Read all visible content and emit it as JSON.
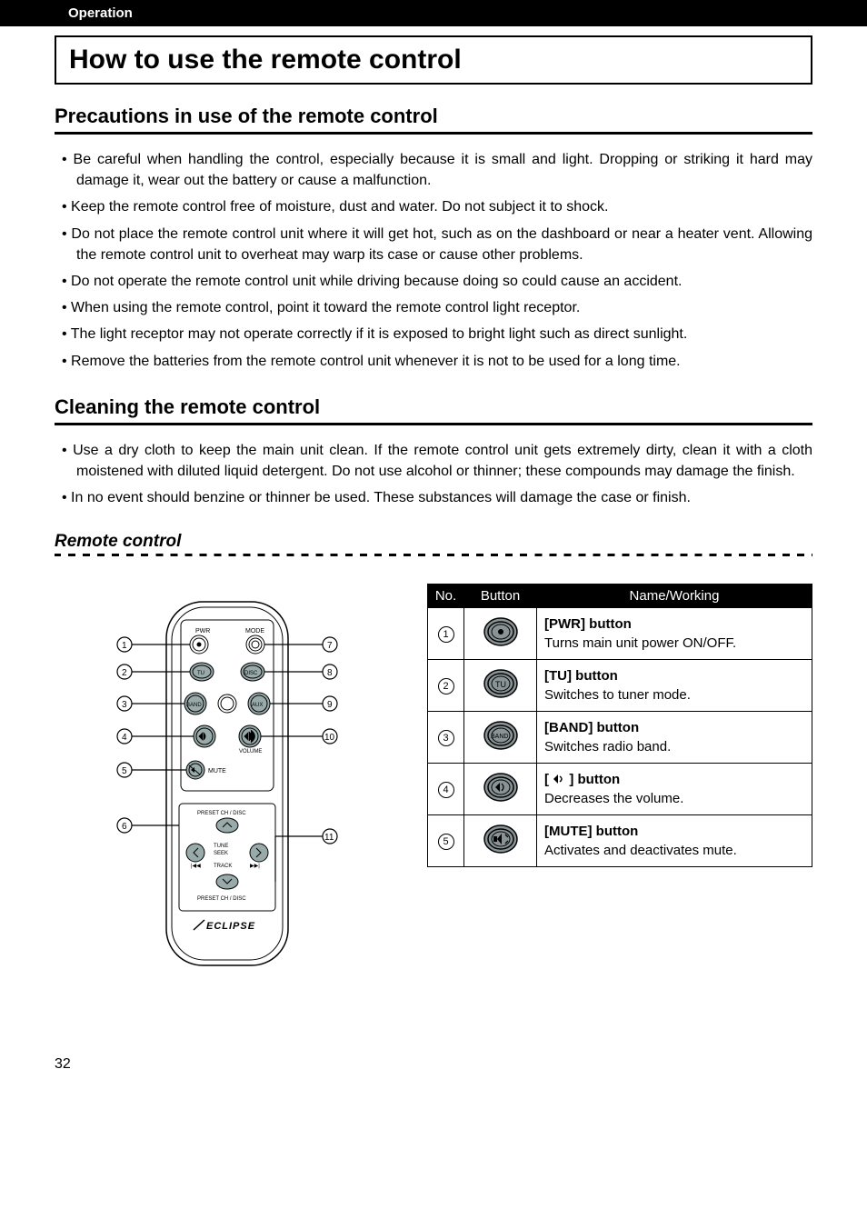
{
  "header_bar": "Operation",
  "page_title": "How to use the remote control",
  "sections": {
    "precautions": {
      "title": "Precautions in use of the remote control",
      "items": [
        "Be careful when handling the control, especially because it is small and light. Dropping or striking it hard may damage it, wear out the battery or cause a malfunction.",
        "Keep the remote control free of moisture, dust and water. Do not subject it to shock.",
        "Do not place the remote control unit where it will get hot, such as on the dashboard or near a heater vent. Allowing the remote control unit to overheat may warp its case or cause other problems.",
        "Do not operate the remote control unit while driving because doing so could cause an accident.",
        "When using the remote control, point it toward the remote control light receptor.",
        "The light receptor may not operate correctly if it is exposed to bright light such as direct sunlight.",
        "Remove the batteries from the remote control unit whenever it is not to be used for a long time."
      ]
    },
    "cleaning": {
      "title": "Cleaning the remote control",
      "items": [
        "Use a dry cloth to keep the main unit clean. If the remote control unit gets extremely dirty, clean it with a cloth moistened with diluted liquid detergent. Do not use alcohol or thinner; these compounds may damage the finish.",
        "In no event should benzine or thinner be used. These substances will damage the case or finish."
      ]
    }
  },
  "remote_heading": "Remote control",
  "table": {
    "headers": {
      "no": "No.",
      "button": "Button",
      "name": "Name/Working"
    },
    "rows": [
      {
        "num": "1",
        "btn_label": "",
        "name": "[PWR] button",
        "desc": "Turns main unit power ON/OFF."
      },
      {
        "num": "2",
        "btn_label": "TU",
        "name": "[TU] button",
        "desc": "Switches to tuner mode."
      },
      {
        "num": "3",
        "btn_label": "BAND",
        "name": "[BAND] button",
        "desc": "Switches radio band."
      },
      {
        "num": "4",
        "btn_label": "",
        "name_prefix": "[ ",
        "name_suffix": " ] button",
        "desc": "Decreases the volume."
      },
      {
        "num": "5",
        "btn_label": "",
        "name": "[MUTE] button",
        "desc": "Activates and deactivates mute."
      }
    ]
  },
  "remote_labels": {
    "pwr": "PWR",
    "mode": "MODE",
    "tu": "TU",
    "disc": "DISC",
    "band": "BAND",
    "aux": "AUX",
    "mute": "MUTE",
    "volume": "VOLUME",
    "preset_top": "PRESET CH / DISC",
    "tune": "TUNE",
    "seek": "SEEK",
    "track": "TRACK",
    "preset_bottom": "PRESET CH / DISC",
    "brand": "ECLIPSE"
  },
  "page_number": "32"
}
